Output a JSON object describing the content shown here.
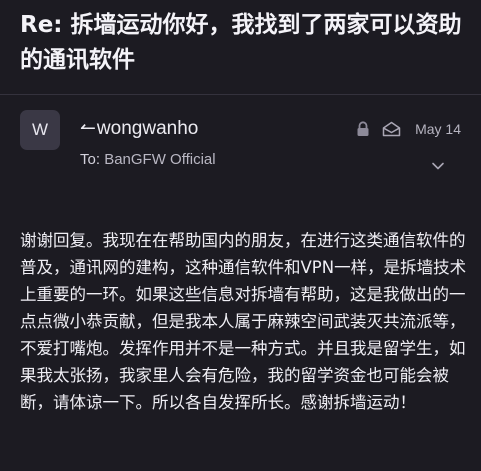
{
  "message": {
    "subject": "Re: 拆墙运动你好，我找到了两家可以资助的通讯软件",
    "avatar_initial": "W",
    "from_name": "wongwanho",
    "to_label": "To:",
    "to_name": "BanGFW Official",
    "date": "May 14",
    "body": "谢谢回复。我现在在帮助国内的朋友，在进行这类通信软件的普及，通讯网的建构，这种通信软件和VPN一样，是拆墙技术上重要的一环。如果这些信息对拆墙有帮助，这是我做出的一点点微小恭贡献，但是我本人属于麻辣空间武装灭共流派等，不爱打嘴炮。发挥作用并不是一种方式。并且我是留学生，如果我太张扬，我家里人会有危险，我的留学资金也可能会被断，请体谅一下。所以各自发挥所长。感谢拆墙运动！"
  },
  "icons": {
    "reply": "reply-arrow-icon",
    "lock": "lock-icon",
    "read": "envelope-open-icon",
    "expand": "chevron-down-icon"
  },
  "colors": {
    "background": "#1c1b22",
    "avatar_bg": "#3a3845",
    "muted": "#b6b4c0"
  }
}
